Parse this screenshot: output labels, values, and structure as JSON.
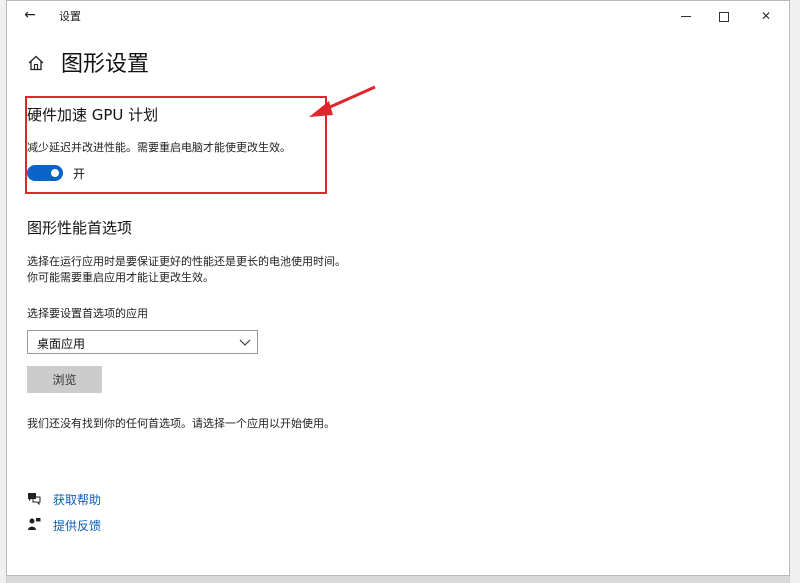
{
  "window": {
    "title": "设置",
    "back_glyph": "←",
    "close_glyph": "✕"
  },
  "page": {
    "title": "图形设置"
  },
  "gpu_scheduling": {
    "heading": "硬件加速 GPU 计划",
    "description": "减少延迟并改进性能。需要重启电脑才能使更改生效。",
    "toggle_state": "on",
    "toggle_label": "开"
  },
  "preferences": {
    "heading": "图形性能首选项",
    "desc_line1": "选择在运行应用时是要保证更好的性能还是更长的电池使用时间。",
    "desc_line2": "你可能需要重启应用才能让更改生效。",
    "select_label": "选择要设置首选项的应用",
    "select_value": "桌面应用",
    "browse_label": "浏览",
    "empty_message": "我们还没有找到你的任何首选项。请选择一个应用以开始使用。"
  },
  "help": {
    "get_help": "获取帮助",
    "feedback": "提供反馈"
  },
  "colors": {
    "accent": "#0a64c8",
    "highlight": "#e0262d",
    "link": "#0b5eb5"
  },
  "icons": {
    "back": "arrow-left-icon",
    "home": "home-icon",
    "chevron": "chevron-down-icon",
    "help": "chat-help-icon",
    "feedback": "person-feedback-icon"
  }
}
